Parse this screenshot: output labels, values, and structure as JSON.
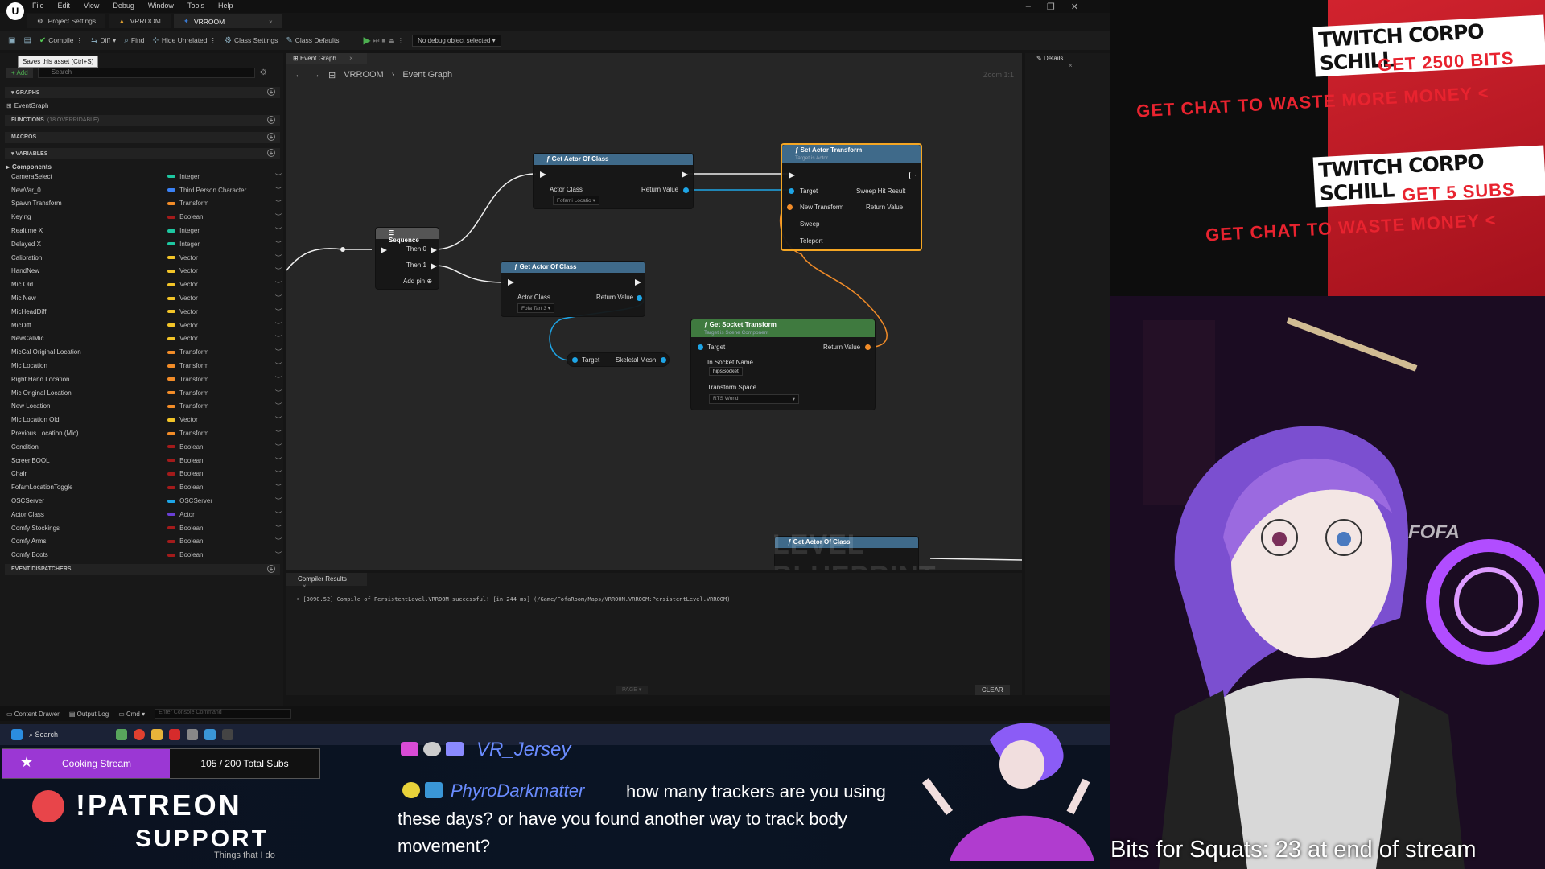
{
  "menu": [
    "File",
    "Edit",
    "View",
    "Debug",
    "Window",
    "Tools",
    "Help"
  ],
  "tabs": [
    "Project Settings",
    "VRROOM",
    "VRROOM"
  ],
  "toolbar": {
    "compile": "Compile",
    "diff": "Diff",
    "find": "Find",
    "hide": "Hide Unrelated",
    "class_settings": "Class Settings",
    "class_defaults": "Class Defaults",
    "debug_select": "No debug object selected"
  },
  "tooltip": "Saves this asset (Ctrl+S)",
  "mybp": {
    "add": "+ Add",
    "search_placeholder": "Search",
    "graphs": "GRAPHS",
    "event_graph": "EventGraph",
    "functions": "FUNCTIONS",
    "functions_hint": "(18 OVERRIDABLE)",
    "macros": "MACROS",
    "variables": "VARIABLES",
    "components": "Components",
    "dispatchers": "EVENT DISPATCHERS",
    "vars": [
      {
        "name": "CameraSelect",
        "type": "Integer",
        "color": "#1ec7a1"
      },
      {
        "name": "NewVar_0",
        "type": "Third Person Character",
        "color": "#3b82f6"
      },
      {
        "name": "Spawn Transform",
        "type": "Transform",
        "color": "#f28c28"
      },
      {
        "name": "Keying",
        "type": "Boolean",
        "color": "#a31b1b"
      },
      {
        "name": "Realtime X",
        "type": "Integer",
        "color": "#1ec7a1"
      },
      {
        "name": "Delayed X",
        "type": "Integer",
        "color": "#1ec7a1"
      },
      {
        "name": "Calibration",
        "type": "Vector",
        "color": "#f2c428"
      },
      {
        "name": "HandNew",
        "type": "Vector",
        "color": "#f2c428"
      },
      {
        "name": "Mic Old",
        "type": "Vector",
        "color": "#f2c428"
      },
      {
        "name": "Mic New",
        "type": "Vector",
        "color": "#f2c428"
      },
      {
        "name": "MicHeadDiff",
        "type": "Vector",
        "color": "#f2c428"
      },
      {
        "name": "MicDiff",
        "type": "Vector",
        "color": "#f2c428"
      },
      {
        "name": "NewCalMic",
        "type": "Vector",
        "color": "#f2c428"
      },
      {
        "name": "MicCal Original Location",
        "type": "Transform",
        "color": "#f28c28"
      },
      {
        "name": "Mic Location",
        "type": "Transform",
        "color": "#f28c28"
      },
      {
        "name": "Right Hand Location",
        "type": "Transform",
        "color": "#f28c28"
      },
      {
        "name": "Mic Original Location",
        "type": "Transform",
        "color": "#f28c28"
      },
      {
        "name": "New Location",
        "type": "Transform",
        "color": "#f28c28"
      },
      {
        "name": "Mic Location Old",
        "type": "Vector",
        "color": "#f2c428"
      },
      {
        "name": "Previous Location (Mic)",
        "type": "Transform",
        "color": "#f28c28"
      },
      {
        "name": "Condition",
        "type": "Boolean",
        "color": "#a31b1b"
      },
      {
        "name": "ScreenBOOL",
        "type": "Boolean",
        "color": "#a31b1b"
      },
      {
        "name": "Chair",
        "type": "Boolean",
        "color": "#a31b1b"
      },
      {
        "name": "FofamLocationToggle",
        "type": "Boolean",
        "color": "#a31b1b"
      },
      {
        "name": "OSCServer",
        "type": "OSCServer",
        "color": "#1ea5e6"
      },
      {
        "name": "Actor Class",
        "type": "Actor",
        "color": "#6a3fd4"
      },
      {
        "name": "Comfy Stockings",
        "type": "Boolean",
        "color": "#a31b1b"
      },
      {
        "name": "Comfy Arms",
        "type": "Boolean",
        "color": "#a31b1b"
      },
      {
        "name": "Comfy Boots",
        "type": "Boolean",
        "color": "#a31b1b"
      }
    ]
  },
  "graph": {
    "tab": "Event Graph",
    "crumb_root": "VRROOM",
    "crumb_leaf": "Event Graph",
    "zoom": "Zoom 1:1",
    "watermark": "LEVEL BLUEPRINT",
    "nodes": {
      "get_actor1": {
        "title": "Get Actor Of Class",
        "actor_class": "Actor Class",
        "ret": "Return Value",
        "value": "Fofami Locatio"
      },
      "get_actor2": {
        "title": "Get Actor Of Class",
        "actor_class": "Actor Class",
        "ret": "Return Value",
        "value": "Fofa Tart 3"
      },
      "get_actor3": {
        "title": "Get Actor Of Class"
      },
      "sequence": {
        "title": "Sequence",
        "then0": "Then 0",
        "then1": "Then 1",
        "add": "Add pin"
      },
      "set_actor": {
        "title": "Set Actor Transform",
        "sub": "Target is Actor",
        "target": "Target",
        "sweep_hit": "Sweep Hit Result",
        "new_transform": "New Transform",
        "ret": "Return Value",
        "sweep": "Sweep",
        "teleport": "Teleport"
      },
      "socket": {
        "title": "Get Socket Transform",
        "sub": "Target is Scene Component",
        "target": "Target",
        "ret": "Return Value",
        "socket_name": "In Socket Name",
        "socket_value": "hipsSocket",
        "space": "Transform Space",
        "space_value": "RTS World"
      },
      "skeletal": {
        "target": "Target",
        "mesh": "Skeletal Mesh"
      }
    }
  },
  "compiler": {
    "tab": "Compiler Results",
    "message": "[3090.52] Compile of PersistentLevel.VRROOM successful! [in 244 ms] (/Game/FofaRoom/Maps/VRROOM.VRROOM:PersistentLevel.VRROOM)",
    "page": "PAGE",
    "clear": "CLEAR"
  },
  "details": {
    "tab": "Details"
  },
  "status": {
    "content": "Content Drawer",
    "output": "Output Log",
    "cmd": "Cmd",
    "console": "Enter Console Command"
  },
  "taskbar": {
    "search": "Search"
  },
  "alert": {
    "title1": "TWITCH CORPO SCHILL",
    "line1": "GET 2500 BITS",
    "line2": "GET CHAT TO WASTE MORE MONEY <",
    "title2": "TWITCH CORPO SCHILL",
    "line3": "GET 5 SUBS",
    "line4": "GET CHAT TO WASTE MONEY <"
  },
  "overlay": {
    "cooking": "Cooking Stream",
    "subs": "105 / 200 Total Subs",
    "patreon1": "!PATREON",
    "patreon2": "SUPPORT",
    "patreon3": "Things that I do",
    "chat_user1": "VR_Jersey",
    "chat_user2": "PhyroDarkmatter",
    "chat_msg": "how many trackers are you using these days? or have you found another way to track body movement?",
    "squats": "Bits for Squats: 23 at end of stream",
    "cam_sign": "FOFA"
  }
}
